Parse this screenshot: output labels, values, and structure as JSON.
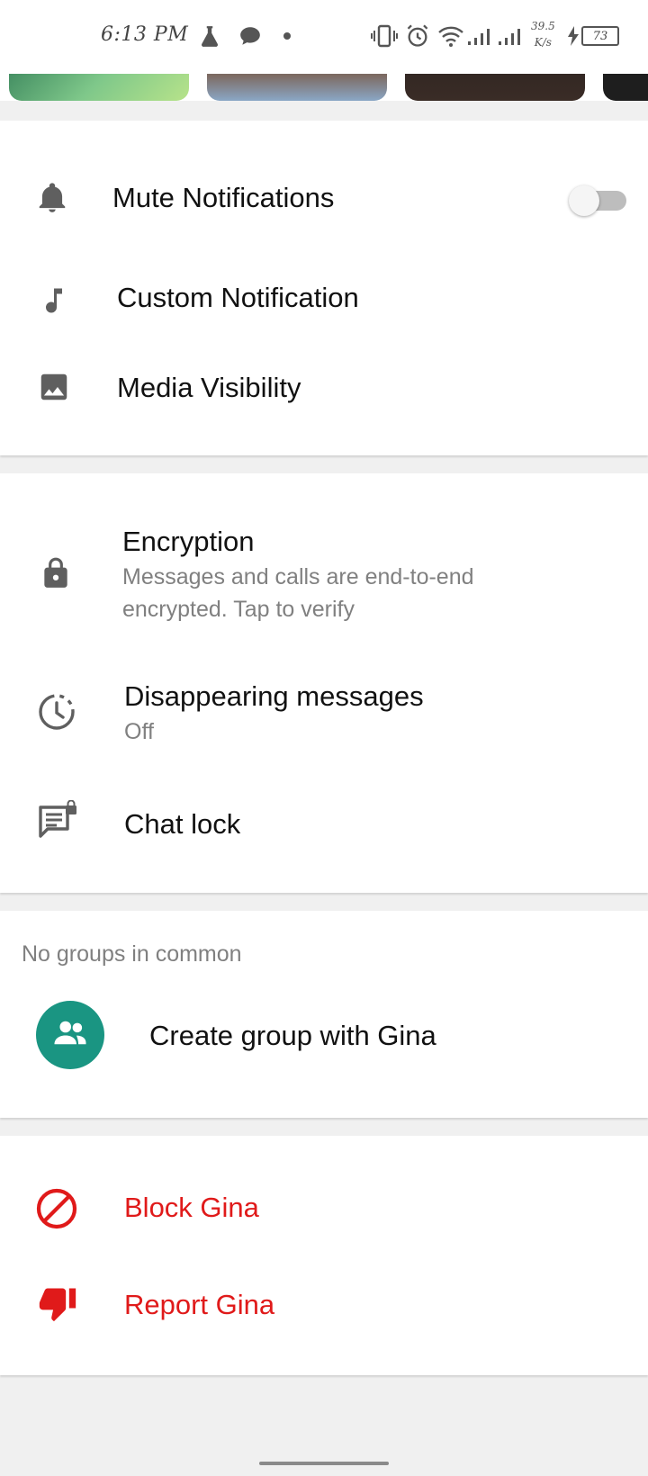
{
  "status_bar": {
    "time": "6:13 PM",
    "net_speed_value": "39.5",
    "net_speed_unit": "K/s",
    "battery": "73"
  },
  "notifications": {
    "mute_label": "Mute Notifications",
    "mute_enabled": false,
    "custom_label": "Custom Notification",
    "media_label": "Media Visibility"
  },
  "privacy": {
    "encryption_title": "Encryption",
    "encryption_sub_line1": "Messages and calls are end-to-end",
    "encryption_sub_line2": "encrypted. Tap to verify",
    "disappearing_title": "Disappearing messages",
    "disappearing_value": "Off",
    "chat_lock_label": "Chat lock"
  },
  "groups": {
    "header": "No groups in common",
    "create_label": "Create group with Gina"
  },
  "actions": {
    "block_label": "Block Gina",
    "report_label": "Report Gina"
  },
  "colors": {
    "accent": "#1a9582",
    "danger": "#e01a1a",
    "icon": "#5f5f5f"
  }
}
